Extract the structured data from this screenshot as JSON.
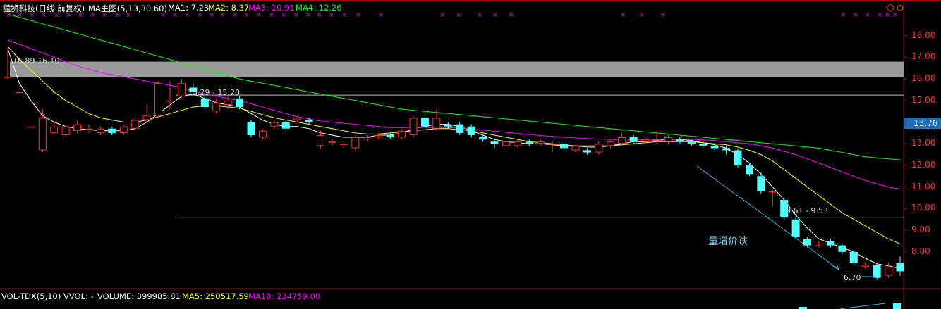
{
  "header": {
    "stock": "猛狮科技(日线 前复权)",
    "indicator": "MA主图(5,13,30,60)",
    "ma1": "MA1: 7.23",
    "ma2": "MA2: 8.37",
    "ma3": "MA3: 10.91",
    "ma4": "MA4: 12.26"
  },
  "volume_header": {
    "name": "VOL-TDX(5,10)",
    "vvol": "VVOL: -",
    "volume": "VOLUME: 399985.81",
    "ma5": "MA5: 250517.59",
    "ma10": "MA10: 234759.00"
  },
  "current_price": "13.76",
  "annotations": {
    "high": "16.89  16.10",
    "range1": "15.29 - 15.20",
    "range2": "9.61 - 9.53",
    "low": "6.70",
    "note": "量增价跌"
  },
  "colors": {
    "up": "#ff3232",
    "down": "#54ffff",
    "ma1": "#ffffff",
    "ma2": "#ffff00",
    "ma3": "#ff00ff",
    "ma4": "#00ff00",
    "axis": "#b00000",
    "band": "#9a9a9a"
  },
  "chart_data": {
    "type": "candlestick",
    "ylim": [
      6.3,
      19.0
    ],
    "y_ticks": [
      8.0,
      9.0,
      10.0,
      11.0,
      12.0,
      13.0,
      14.0,
      15.0,
      16.0,
      17.0,
      18.0
    ],
    "y_tick_labels": [
      "8.00",
      "9.00",
      "10.00",
      "11.00",
      "12.00",
      "13.00",
      "14.00",
      "15.00",
      "16.00",
      "17.00",
      "18.00"
    ],
    "resistance_band": [
      16.1,
      16.8
    ],
    "reference_lines": [
      15.25,
      9.6
    ],
    "candles": [
      {
        "o": 16.1,
        "c": 16.1,
        "h": 17.4,
        "l": 16.0
      },
      {
        "o": 15.4,
        "c": 15.4,
        "h": 15.4,
        "l": 15.4
      },
      {
        "o": 13.8,
        "c": 13.8,
        "h": 13.8,
        "l": 13.8
      },
      {
        "o": 12.7,
        "c": 14.2,
        "h": 14.6,
        "l": 12.6
      },
      {
        "o": 13.5,
        "c": 13.8,
        "h": 14.0,
        "l": 13.4
      },
      {
        "o": 13.4,
        "c": 13.8,
        "h": 13.9,
        "l": 13.3
      },
      {
        "o": 13.6,
        "c": 13.9,
        "h": 14.1,
        "l": 13.5
      },
      {
        "o": 13.7,
        "c": 13.7,
        "h": 13.9,
        "l": 13.5
      },
      {
        "o": 13.5,
        "c": 13.7,
        "h": 13.8,
        "l": 13.4
      },
      {
        "o": 13.7,
        "c": 13.5,
        "h": 13.8,
        "l": 13.4
      },
      {
        "o": 13.5,
        "c": 13.8,
        "h": 13.9,
        "l": 13.4
      },
      {
        "o": 13.7,
        "c": 14.1,
        "h": 14.3,
        "l": 13.6
      },
      {
        "o": 14.1,
        "c": 14.3,
        "h": 14.8,
        "l": 14.0
      },
      {
        "o": 14.3,
        "c": 15.8,
        "h": 15.9,
        "l": 14.2
      },
      {
        "o": 15.0,
        "c": 15.0,
        "h": 15.9,
        "l": 14.6
      },
      {
        "o": 15.2,
        "c": 15.8,
        "h": 16.0,
        "l": 15.1
      },
      {
        "o": 15.6,
        "c": 15.4,
        "h": 15.8,
        "l": 15.3
      },
      {
        "o": 15.1,
        "c": 14.7,
        "h": 15.2,
        "l": 14.6
      },
      {
        "o": 14.5,
        "c": 14.9,
        "h": 15.1,
        "l": 14.4
      },
      {
        "o": 14.8,
        "c": 15.0,
        "h": 15.2,
        "l": 14.6
      },
      {
        "o": 15.1,
        "c": 14.7,
        "h": 15.2,
        "l": 14.6
      },
      {
        "o": 14.0,
        "c": 13.4,
        "h": 14.1,
        "l": 13.3
      },
      {
        "o": 13.3,
        "c": 13.6,
        "h": 13.7,
        "l": 13.2
      },
      {
        "o": 13.8,
        "c": 14.0,
        "h": 14.1,
        "l": 13.7
      },
      {
        "o": 14.0,
        "c": 13.7,
        "h": 14.1,
        "l": 13.6
      },
      {
        "o": 14.1,
        "c": 14.2,
        "h": 14.3,
        "l": 14.0
      },
      {
        "o": 14.1,
        "c": 14.0,
        "h": 14.2,
        "l": 13.9
      },
      {
        "o": 12.9,
        "c": 13.4,
        "h": 13.6,
        "l": 12.8
      },
      {
        "o": 13.1,
        "c": 13.1,
        "h": 13.2,
        "l": 12.9
      },
      {
        "o": 13.0,
        "c": 13.0,
        "h": 13.1,
        "l": 12.8
      },
      {
        "o": 12.8,
        "c": 13.3,
        "h": 13.4,
        "l": 12.7
      },
      {
        "o": 13.2,
        "c": 13.3,
        "h": 13.4,
        "l": 13.1
      },
      {
        "o": 13.3,
        "c": 13.4,
        "h": 13.5,
        "l": 13.2
      },
      {
        "o": 13.4,
        "c": 13.3,
        "h": 13.5,
        "l": 13.2
      },
      {
        "o": 13.3,
        "c": 13.6,
        "h": 13.7,
        "l": 13.2
      },
      {
        "o": 13.4,
        "c": 14.2,
        "h": 14.3,
        "l": 13.3
      },
      {
        "o": 14.2,
        "c": 13.8,
        "h": 14.3,
        "l": 13.7
      },
      {
        "o": 13.7,
        "c": 14.2,
        "h": 14.6,
        "l": 13.6
      },
      {
        "o": 13.9,
        "c": 13.8,
        "h": 14.0,
        "l": 13.7
      },
      {
        "o": 13.9,
        "c": 13.5,
        "h": 14.0,
        "l": 13.4
      },
      {
        "o": 13.8,
        "c": 13.4,
        "h": 13.9,
        "l": 13.3
      },
      {
        "o": 13.3,
        "c": 13.2,
        "h": 13.4,
        "l": 13.1
      },
      {
        "o": 13.1,
        "c": 13.0,
        "h": 13.2,
        "l": 12.8
      },
      {
        "o": 12.9,
        "c": 13.1,
        "h": 13.2,
        "l": 12.8
      },
      {
        "o": 12.9,
        "c": 13.1,
        "h": 13.2,
        "l": 12.8
      },
      {
        "o": 13.1,
        "c": 13.0,
        "h": 13.2,
        "l": 12.9
      },
      {
        "o": 13.0,
        "c": 13.1,
        "h": 13.2,
        "l": 12.9
      },
      {
        "o": 13.0,
        "c": 13.0,
        "h": 13.1,
        "l": 12.6
      },
      {
        "o": 13.0,
        "c": 12.8,
        "h": 13.1,
        "l": 12.7
      },
      {
        "o": 12.7,
        "c": 12.9,
        "h": 13.0,
        "l": 12.6
      },
      {
        "o": 12.7,
        "c": 12.6,
        "h": 12.8,
        "l": 12.5
      },
      {
        "o": 12.6,
        "c": 13.0,
        "h": 13.1,
        "l": 12.5
      },
      {
        "o": 12.9,
        "c": 13.1,
        "h": 13.2,
        "l": 12.8
      },
      {
        "o": 13.0,
        "c": 13.3,
        "h": 13.5,
        "l": 12.9
      },
      {
        "o": 13.3,
        "c": 13.1,
        "h": 13.4,
        "l": 13.0
      },
      {
        "o": 13.1,
        "c": 13.2,
        "h": 13.3,
        "l": 13.0
      },
      {
        "o": 13.2,
        "c": 13.2,
        "h": 13.6,
        "l": 13.0
      },
      {
        "o": 13.1,
        "c": 13.3,
        "h": 13.4,
        "l": 13.0
      },
      {
        "o": 13.2,
        "c": 13.1,
        "h": 13.3,
        "l": 13.0
      },
      {
        "o": 13.1,
        "c": 13.0,
        "h": 13.2,
        "l": 12.9
      },
      {
        "o": 13.0,
        "c": 12.9,
        "h": 13.1,
        "l": 12.8
      },
      {
        "o": 12.9,
        "c": 12.8,
        "h": 13.0,
        "l": 12.7
      },
      {
        "o": 12.8,
        "c": 12.7,
        "h": 12.9,
        "l": 12.5
      },
      {
        "o": 12.7,
        "c": 12.0,
        "h": 12.8,
        "l": 11.9
      },
      {
        "o": 12.0,
        "c": 11.6,
        "h": 12.1,
        "l": 11.5
      },
      {
        "o": 11.5,
        "c": 10.8,
        "h": 11.7,
        "l": 10.7
      },
      {
        "o": 10.8,
        "c": 10.8,
        "h": 10.9,
        "l": 10.1
      },
      {
        "o": 10.4,
        "c": 9.6,
        "h": 10.5,
        "l": 9.5
      },
      {
        "o": 9.5,
        "c": 8.7,
        "h": 9.6,
        "l": 8.6
      },
      {
        "o": 8.6,
        "c": 8.3,
        "h": 8.7,
        "l": 8.2
      },
      {
        "o": 8.3,
        "c": 8.3,
        "h": 8.5,
        "l": 8.2
      },
      {
        "o": 8.5,
        "c": 8.3,
        "h": 8.6,
        "l": 8.2
      },
      {
        "o": 8.3,
        "c": 8.0,
        "h": 8.4,
        "l": 7.9
      },
      {
        "o": 8.0,
        "c": 7.5,
        "h": 8.1,
        "l": 7.4
      },
      {
        "o": 7.3,
        "c": 7.4,
        "h": 7.5,
        "l": 7.2
      },
      {
        "o": 7.4,
        "c": 6.8,
        "h": 7.5,
        "l": 6.7
      },
      {
        "o": 6.9,
        "c": 7.3,
        "h": 7.5,
        "l": 6.8
      },
      {
        "o": 7.5,
        "c": 7.1,
        "h": 7.8,
        "l": 6.9
      }
    ],
    "volume_bars": [
      0.05,
      0.4
    ],
    "series": [
      {
        "name": "MA1",
        "values": [
          17.4,
          15.8,
          15.0,
          14.3,
          14.0,
          13.8,
          13.7,
          13.65,
          13.6,
          13.6,
          13.6,
          13.7,
          14.0,
          14.4,
          14.8,
          15.2,
          15.3,
          15.1,
          14.9,
          14.8,
          14.7,
          14.4,
          14.1,
          13.9,
          13.8,
          13.8,
          13.7,
          13.5,
          13.4,
          13.3,
          13.3,
          13.3,
          13.4,
          13.4,
          13.5,
          13.7,
          13.8,
          13.9,
          13.9,
          13.8,
          13.6,
          13.4,
          13.2,
          13.1,
          13.05,
          13.0,
          13.0,
          12.95,
          12.9,
          12.9,
          12.85,
          12.85,
          12.9,
          13.0,
          13.1,
          13.1,
          13.15,
          13.2,
          13.2,
          13.15,
          13.05,
          12.95,
          12.8,
          12.5,
          12.1,
          11.6,
          11.0,
          10.4,
          9.7,
          9.1,
          8.6,
          8.4,
          8.2,
          8.0,
          7.7,
          7.45,
          7.35,
          7.23
        ]
      },
      {
        "name": "MA2",
        "values": [
          17.5,
          16.9,
          16.4,
          15.9,
          15.4,
          15.0,
          14.7,
          14.4,
          14.2,
          14.1,
          14.0,
          14.0,
          14.1,
          14.25,
          14.4,
          14.55,
          14.7,
          14.75,
          14.75,
          14.7,
          14.65,
          14.5,
          14.35,
          14.2,
          14.1,
          14.0,
          13.9,
          13.8,
          13.7,
          13.6,
          13.5,
          13.45,
          13.45,
          13.5,
          13.55,
          13.6,
          13.65,
          13.7,
          13.7,
          13.65,
          13.6,
          13.5,
          13.4,
          13.3,
          13.2,
          13.1,
          13.05,
          13.0,
          12.95,
          12.9,
          12.9,
          12.9,
          12.9,
          12.95,
          13.0,
          13.05,
          13.1,
          13.1,
          13.1,
          13.1,
          13.05,
          13.0,
          12.95,
          12.85,
          12.7,
          12.5,
          12.2,
          11.8,
          11.4,
          11.0,
          10.6,
          10.2,
          9.8,
          9.5,
          9.2,
          8.9,
          8.6,
          8.37
        ]
      },
      {
        "name": "MA3",
        "values": [
          17.8,
          17.6,
          17.4,
          17.2,
          17.0,
          16.8,
          16.6,
          16.45,
          16.3,
          16.2,
          16.1,
          16.0,
          15.9,
          15.8,
          15.7,
          15.6,
          15.45,
          15.3,
          15.2,
          15.1,
          15.0,
          14.85,
          14.7,
          14.55,
          14.4,
          14.25,
          14.15,
          14.05,
          14.0,
          13.95,
          13.9,
          13.85,
          13.8,
          13.75,
          13.75,
          13.75,
          13.75,
          13.75,
          13.75,
          13.72,
          13.68,
          13.63,
          13.58,
          13.53,
          13.48,
          13.43,
          13.38,
          13.34,
          13.3,
          13.27,
          13.24,
          13.22,
          13.2,
          13.2,
          13.2,
          13.2,
          13.2,
          13.2,
          13.2,
          13.2,
          13.18,
          13.15,
          13.1,
          13.05,
          13.0,
          12.9,
          12.8,
          12.65,
          12.5,
          12.3,
          12.1,
          11.9,
          11.7,
          11.5,
          11.3,
          11.15,
          11.0,
          10.91
        ]
      },
      {
        "name": "MA4",
        "values": [
          19.0,
          18.85,
          18.7,
          18.55,
          18.4,
          18.25,
          18.1,
          17.95,
          17.8,
          17.65,
          17.5,
          17.35,
          17.2,
          17.05,
          16.9,
          16.75,
          16.6,
          16.45,
          16.3,
          16.15,
          16.0,
          15.9,
          15.8,
          15.7,
          15.6,
          15.5,
          15.4,
          15.3,
          15.2,
          15.1,
          15.0,
          14.9,
          14.8,
          14.7,
          14.6,
          14.55,
          14.5,
          14.45,
          14.4,
          14.35,
          14.3,
          14.25,
          14.2,
          14.15,
          14.1,
          14.05,
          14.0,
          13.95,
          13.9,
          13.85,
          13.8,
          13.75,
          13.7,
          13.65,
          13.6,
          13.55,
          13.5,
          13.45,
          13.4,
          13.35,
          13.3,
          13.25,
          13.2,
          13.15,
          13.1,
          13.05,
          13.0,
          12.95,
          12.9,
          12.85,
          12.8,
          12.7,
          12.6,
          12.5,
          12.4,
          12.35,
          12.3,
          12.26
        ]
      }
    ]
  }
}
